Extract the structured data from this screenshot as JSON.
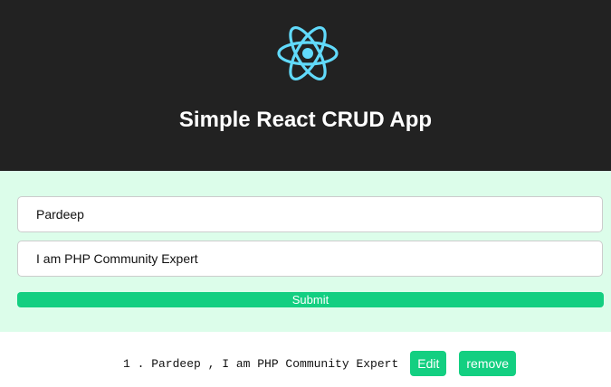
{
  "header": {
    "title": "Simple React CRUD App",
    "logo_icon": "react-logo-icon",
    "background": "#222222",
    "logo_color": "#61dafb"
  },
  "form": {
    "background": "#dcfdea",
    "name_value": "Pardeep",
    "description_value": "I am PHP Community Expert",
    "submit_label": "Submit",
    "accent": "#13cf81"
  },
  "list": {
    "items": [
      {
        "text": "1 . Pardeep , I am PHP Community Expert",
        "edit_label": "Edit",
        "remove_label": "remove"
      }
    ]
  }
}
